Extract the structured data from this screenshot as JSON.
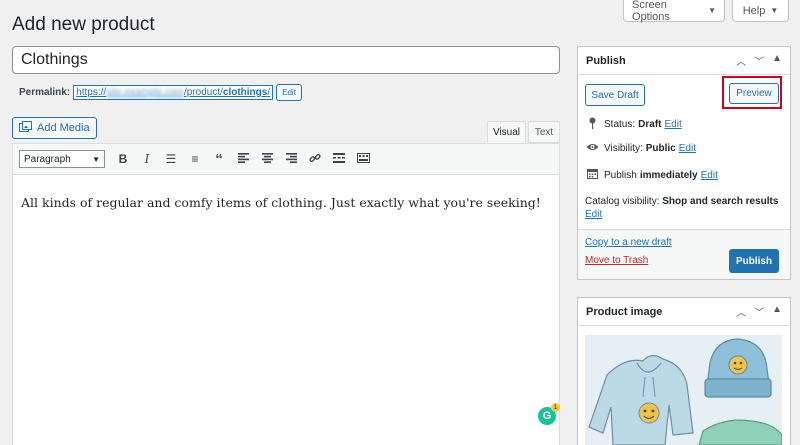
{
  "header": {
    "title": "Add new product",
    "screen_options": "Screen Options",
    "help": "Help"
  },
  "product": {
    "title_value": "Clothings"
  },
  "permalink": {
    "label": "Permalink:",
    "url_prefix": "https://",
    "url_blurred": "site.example.com",
    "url_path": "/product/",
    "url_slug": "clothings",
    "url_end": "/",
    "edit": "Edit"
  },
  "editor": {
    "add_media": "Add Media",
    "tab_visual": "Visual",
    "tab_text": "Text",
    "format": "Paragraph",
    "content": "All kinds of regular and comfy items of clothing. Just exactly what you're seeking!",
    "grammarly_count": "1",
    "grammarly_icon": "G"
  },
  "publish": {
    "title": "Publish",
    "save_draft": "Save Draft",
    "preview": "Preview",
    "status_label": "Status:",
    "status_value": "Draft",
    "visibility_label": "Visibility:",
    "visibility_value": "Public",
    "publish_label": "Publish",
    "publish_value": "immediately",
    "catalog_label": "Catalog visibility:",
    "catalog_value": "Shop and search results",
    "edit": "Edit",
    "copy_draft": "Copy to a new draft",
    "trash": "Move to Trash",
    "publish_button": "Publish"
  },
  "product_image": {
    "title": "Product image"
  },
  "colors": {
    "accent": "#2271b1",
    "danger": "#b32d2e",
    "highlight": "#d0021b"
  }
}
